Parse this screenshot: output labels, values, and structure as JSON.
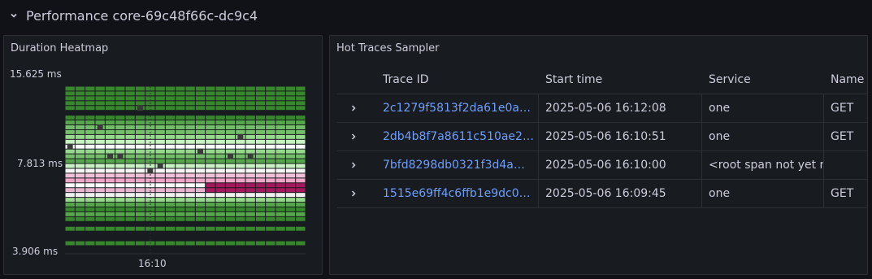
{
  "row": {
    "title": "Performance core-69c48f66c-dc9c4",
    "chevron_icon": "chevron-down-icon"
  },
  "heatmap_panel": {
    "title": "Duration Heatmap"
  },
  "traces_panel": {
    "title": "Hot Traces Sampler",
    "columns": [
      "Trace ID",
      "Start time",
      "Service",
      "Name"
    ],
    "rows": [
      {
        "trace_id": "2c1279f5813f2da61e0a…",
        "start_time": "2025-05-06 16:12:08",
        "service": "one",
        "name": "GET"
      },
      {
        "trace_id": "2db4b8f7a8611c510ae2…",
        "start_time": "2025-05-06 16:10:51",
        "service": "one",
        "name": "GET"
      },
      {
        "trace_id": "7bfd8298db0321f3d4a…",
        "start_time": "2025-05-06 16:10:00",
        "service": "<root span not yet re",
        "name": ""
      },
      {
        "trace_id": "1515e69ff4c6ffb1e9dc0…",
        "start_time": "2025-05-06 16:09:45",
        "service": "one",
        "name": "GET"
      }
    ]
  },
  "chart_data": {
    "type": "heatmap",
    "title": "Duration Heatmap",
    "y_scale": "log2",
    "y_tick_labels": [
      "15.625 ms",
      "7.813 ms",
      "3.906 ms"
    ],
    "y_tick_values_ms": [
      15.625,
      7.813,
      3.906
    ],
    "x_tick_labels": [
      "16:10"
    ],
    "columns": 24,
    "row_colors": [
      "#37872d",
      "#37872d",
      "#37872d",
      "#37872d",
      "#37872d",
      "#111217",
      "#37872d",
      "#56a64b",
      "#73bf69",
      "#73bf69",
      "#96d98d",
      "#c8f2c2",
      "#ffffff",
      "#96d98d",
      "#73bf69",
      "#56a64b",
      "#c8f2c2",
      "#f5f5f5",
      "#f2c0d8",
      "#f2a6c8",
      "#ffffff",
      "#e8b5cf",
      "#f0f0f0",
      "#96d98d",
      "#56a64b",
      "#37872d",
      "#56a64b",
      "#37872d",
      "#111217",
      "#37872d",
      "#111217",
      "#111217",
      "#37872d"
    ],
    "highlight_band": {
      "color": "#a3195b",
      "rows": [
        20,
        21
      ],
      "col_start": 14,
      "col_end": 23
    },
    "colors": {
      "dark": "#37872d",
      "mid": "#56a64b",
      "light": "#96d98d",
      "pale": "#c8f2c2",
      "pink": "#f2a6c8",
      "magenta": "#a3195b"
    },
    "grid": true
  }
}
